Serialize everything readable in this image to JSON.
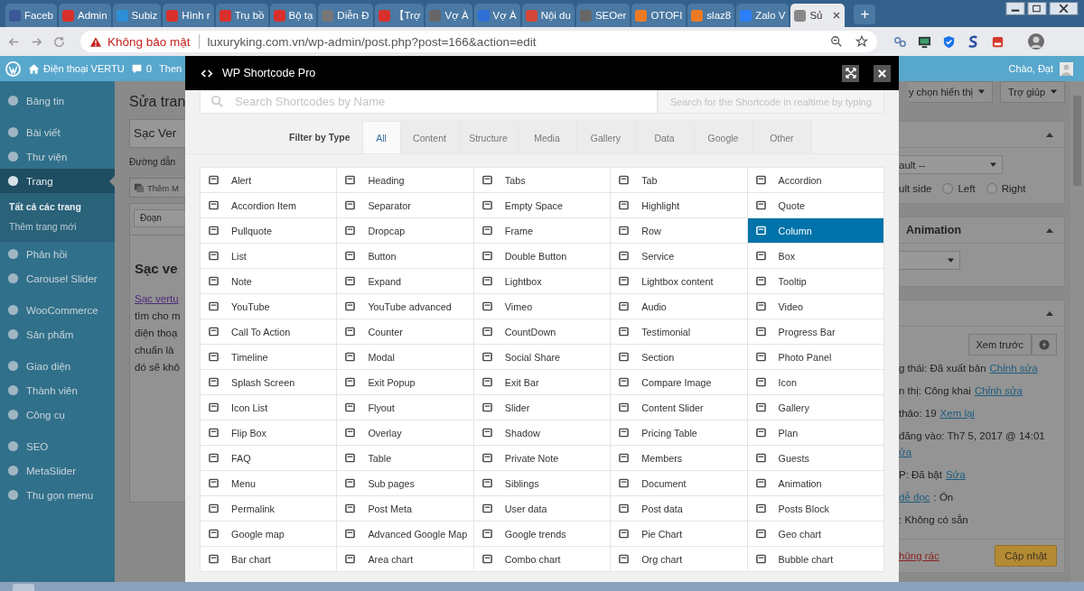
{
  "browser": {
    "tabs": [
      {
        "title": "Faceb",
        "selected": false
      },
      {
        "title": "Admin",
        "selected": false
      },
      {
        "title": "Subiz",
        "selected": false
      },
      {
        "title": "Hình r",
        "selected": false
      },
      {
        "title": "Trụ bồ",
        "selected": false
      },
      {
        "title": "Bộ tạ",
        "selected": false
      },
      {
        "title": "Diễn Đ",
        "selected": false
      },
      {
        "title": "【Trợ",
        "selected": false
      },
      {
        "title": "Vợ À",
        "selected": false
      },
      {
        "title": "Vợ À",
        "selected": false
      },
      {
        "title": "Nội du",
        "selected": false
      },
      {
        "title": "SEOer",
        "selected": false
      },
      {
        "title": "OTOFI",
        "selected": false
      },
      {
        "title": "slaz8",
        "selected": false
      },
      {
        "title": "Zalo V",
        "selected": false
      },
      {
        "title": "Sủ",
        "selected": true
      }
    ],
    "new_tab": "+",
    "address": {
      "security": "Không bảo mật",
      "url": "luxuryking.com.vn/wp-admin/post.php?post=166&action=edit"
    }
  },
  "admin_bar": {
    "site": "Điện thoại VERTU",
    "comments": "0",
    "item_cut": "Then",
    "greeting": "Chào, Đạt"
  },
  "sidebar": {
    "groups": [
      [
        {
          "label": "Bảng tin",
          "selected": false
        }
      ],
      [
        {
          "label": "Bài viết",
          "selected": false
        },
        {
          "label": "Thư viện",
          "selected": false
        },
        {
          "label": "Trang",
          "selected": true,
          "submenu": [
            {
              "label": "Tất cả các trang",
              "selected": true
            },
            {
              "label": "Thêm trang mới",
              "selected": false
            }
          ]
        },
        {
          "label": "Phản hồi",
          "selected": false
        },
        {
          "label": "Carousel Slider",
          "selected": false
        }
      ],
      [
        {
          "label": "WooCommerce",
          "selected": false
        },
        {
          "label": "Sản phẩm",
          "selected": false
        }
      ],
      [
        {
          "label": "Giao diện",
          "selected": false
        },
        {
          "label": "Thành viên",
          "selected": false
        },
        {
          "label": "Công cụ",
          "selected": false
        }
      ],
      [
        {
          "label": "SEO",
          "selected": false
        },
        {
          "label": "MetaSlider",
          "selected": false
        },
        {
          "label": "Thu gọn menu",
          "selected": false
        }
      ]
    ]
  },
  "editor": {
    "title": "Sửa tran",
    "post_title": "Sạc Ver",
    "permalink": "Đường dẫn",
    "add_media": "Thêm M",
    "format": "Đoạn",
    "heading": "Sạc ve",
    "paragraph": [
      {
        "text": "Sạc vertu",
        "link": true
      },
      {
        "text": "tìm cho m",
        "link": false
      },
      {
        "text": "điện thoạ",
        "link": false
      },
      {
        "text": "chuẩn là",
        "link": false
      },
      {
        "text": "đó sẽ khô",
        "link": false
      }
    ]
  },
  "modal": {
    "title": "WP Shortcode Pro",
    "search": {
      "placeholder": "Search Shortcodes by Name",
      "hint": "Search for the Shortcode in realtime by typing"
    },
    "filter": {
      "label": "Filter by Type",
      "types": [
        {
          "label": "All",
          "selected": true
        },
        {
          "label": "Content",
          "selected": false
        },
        {
          "label": "Structure",
          "selected": false
        },
        {
          "label": "Media",
          "selected": false
        },
        {
          "label": "Gallery",
          "selected": false
        },
        {
          "label": "Data",
          "selected": false
        },
        {
          "label": "Google",
          "selected": false
        },
        {
          "label": "Other",
          "selected": false
        }
      ]
    },
    "items": [
      {
        "label": "Alert",
        "selected": false
      },
      {
        "label": "Heading",
        "selected": false
      },
      {
        "label": "Tabs",
        "selected": false
      },
      {
        "label": "Tab",
        "selected": false
      },
      {
        "label": "Accordion",
        "selected": false
      },
      {
        "label": "Accordion Item",
        "selected": false
      },
      {
        "label": "Separator",
        "selected": false
      },
      {
        "label": "Empty Space",
        "selected": false
      },
      {
        "label": "Highlight",
        "selected": false
      },
      {
        "label": "Quote",
        "selected": false
      },
      {
        "label": "Pullquote",
        "selected": false
      },
      {
        "label": "Dropcap",
        "selected": false
      },
      {
        "label": "Frame",
        "selected": false
      },
      {
        "label": "Row",
        "selected": false
      },
      {
        "label": "Column",
        "selected": true
      },
      {
        "label": "List",
        "selected": false
      },
      {
        "label": "Button",
        "selected": false
      },
      {
        "label": "Double Button",
        "selected": false
      },
      {
        "label": "Service",
        "selected": false
      },
      {
        "label": "Box",
        "selected": false
      },
      {
        "label": "Note",
        "selected": false
      },
      {
        "label": "Expand",
        "selected": false
      },
      {
        "label": "Lightbox",
        "selected": false
      },
      {
        "label": "Lightbox content",
        "selected": false
      },
      {
        "label": "Tooltip",
        "selected": false
      },
      {
        "label": "YouTube",
        "selected": false
      },
      {
        "label": "YouTube advanced",
        "selected": false
      },
      {
        "label": "Vimeo",
        "selected": false
      },
      {
        "label": "Audio",
        "selected": false
      },
      {
        "label": "Video",
        "selected": false
      },
      {
        "label": "Call To Action",
        "selected": false
      },
      {
        "label": "Counter",
        "selected": false
      },
      {
        "label": "CountDown",
        "selected": false
      },
      {
        "label": "Testimonial",
        "selected": false
      },
      {
        "label": "Progress Bar",
        "selected": false
      },
      {
        "label": "Timeline",
        "selected": false
      },
      {
        "label": "Modal",
        "selected": false
      },
      {
        "label": "Social Share",
        "selected": false
      },
      {
        "label": "Section",
        "selected": false
      },
      {
        "label": "Photo Panel",
        "selected": false
      },
      {
        "label": "Splash Screen",
        "selected": false
      },
      {
        "label": "Exit Popup",
        "selected": false
      },
      {
        "label": "Exit Bar",
        "selected": false
      },
      {
        "label": "Compare Image",
        "selected": false
      },
      {
        "label": "Icon",
        "selected": false
      },
      {
        "label": "Icon List",
        "selected": false
      },
      {
        "label": "Flyout",
        "selected": false
      },
      {
        "label": "Slider",
        "selected": false
      },
      {
        "label": "Content Slider",
        "selected": false
      },
      {
        "label": "Gallery",
        "selected": false
      },
      {
        "label": "Flip Box",
        "selected": false
      },
      {
        "label": "Overlay",
        "selected": false
      },
      {
        "label": "Shadow",
        "selected": false
      },
      {
        "label": "Pricing Table",
        "selected": false
      },
      {
        "label": "Plan",
        "selected": false
      },
      {
        "label": "FAQ",
        "selected": false
      },
      {
        "label": "Table",
        "selected": false
      },
      {
        "label": "Private Note",
        "selected": false
      },
      {
        "label": "Members",
        "selected": false
      },
      {
        "label": "Guests",
        "selected": false
      },
      {
        "label": "Menu",
        "selected": false
      },
      {
        "label": "Sub pages",
        "selected": false
      },
      {
        "label": "Siblings",
        "selected": false
      },
      {
        "label": "Document",
        "selected": false
      },
      {
        "label": "Animation",
        "selected": false
      },
      {
        "label": "Permalink",
        "selected": false
      },
      {
        "label": "Post Meta",
        "selected": false
      },
      {
        "label": "User data",
        "selected": false
      },
      {
        "label": "Post data",
        "selected": false
      },
      {
        "label": "Posts Block",
        "selected": false
      },
      {
        "label": "Google map",
        "selected": false
      },
      {
        "label": "Advanced Google Map",
        "selected": false
      },
      {
        "label": "Google trends",
        "selected": false
      },
      {
        "label": "Pie Chart",
        "selected": false
      },
      {
        "label": "Geo chart",
        "selected": false
      },
      {
        "label": "Bar chart",
        "selected": false
      },
      {
        "label": "Area chart",
        "selected": false
      },
      {
        "label": "Combo chart",
        "selected": false
      },
      {
        "label": "Org chart",
        "selected": false
      },
      {
        "label": "Bubble chart",
        "selected": false
      }
    ]
  },
  "right": {
    "screen_options": "y chọn hiển thị",
    "help": "Trợ giúp",
    "layout_panel": {
      "select": "ault --",
      "side_label": "ult side",
      "options": [
        {
          "label": "Left",
          "selected": false
        },
        {
          "label": "Right",
          "selected": false
        }
      ]
    },
    "animation_panel": {
      "title": "Animation"
    },
    "publish_panel": {
      "preview": "Xem trước",
      "lines": [
        [
          {
            "text": "g thái: Đã xuất bản",
            "link": false
          },
          {
            "text": "Chỉnh sửa",
            "link": true
          }
        ],
        [
          {
            "text": "n thị: Công khai",
            "link": false
          },
          {
            "text": "Chỉnh sửa",
            "link": true
          }
        ],
        [
          {
            "text": "thảo: 19",
            "link": false
          },
          {
            "text": "Xem lại",
            "link": true
          }
        ],
        [
          {
            "text": "đăng vào: Th7 5, 2017 @ 14:01",
            "link": false
          }
        ],
        [
          {
            "text": "ửa",
            "link": true
          }
        ],
        [
          {
            "text": "P: Đã bật",
            "link": false
          },
          {
            "text": "Sửa",
            "link": true
          }
        ],
        [
          {
            "text": "dễ đọc",
            "link": true
          },
          {
            "text": ": Ổn",
            "link": false
          }
        ],
        [
          {
            "text": ": Không có sẵn",
            "link": false
          }
        ]
      ],
      "trash": "hùng rác",
      "update": "Cập nhật"
    }
  }
}
